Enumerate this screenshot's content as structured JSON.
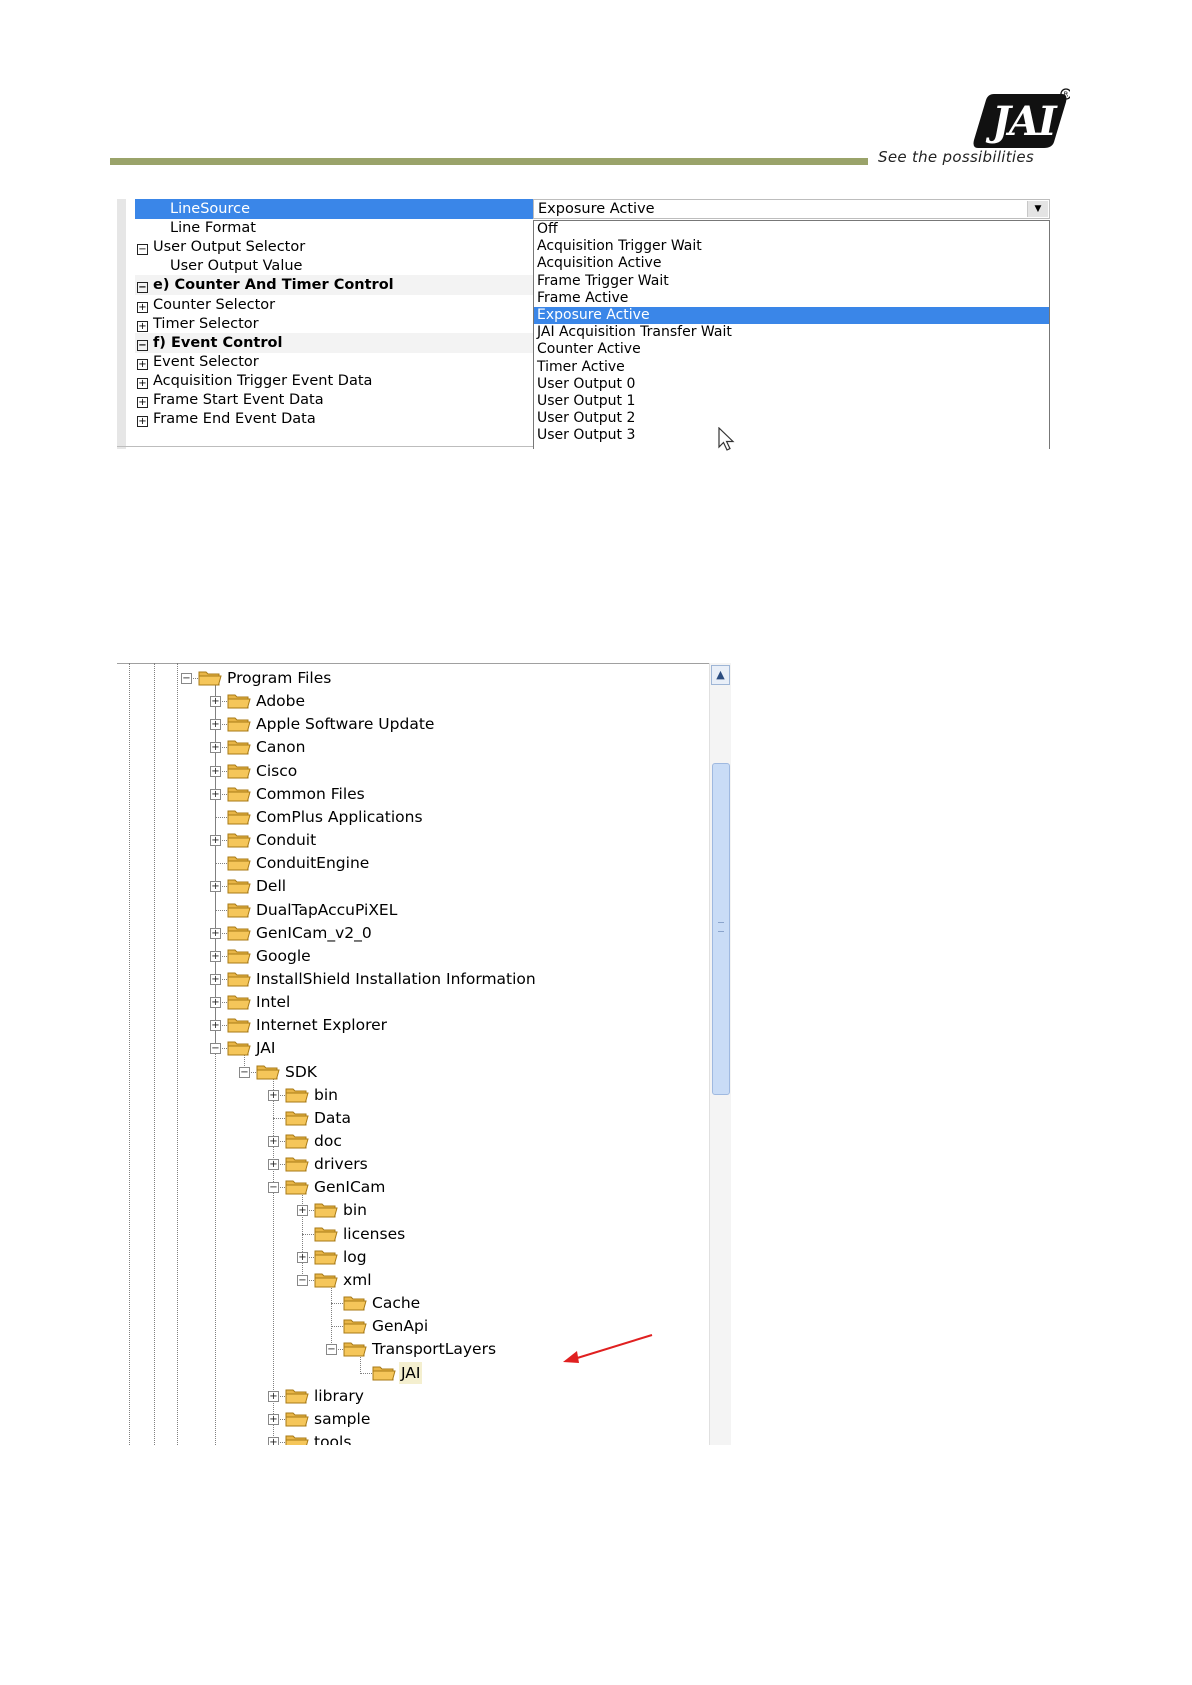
{
  "header": {
    "logo_text": "JAI",
    "tagline": "See the possibilities",
    "rule_color": "#9aa36a"
  },
  "grid": {
    "rows": [
      {
        "label": "LineSource",
        "expander": "",
        "indent": true,
        "style": "sel"
      },
      {
        "label": "Line Format",
        "expander": "",
        "indent": true,
        "style": ""
      },
      {
        "label": "User Output Selector",
        "expander": "⊟",
        "indent": false,
        "style": ""
      },
      {
        "label": "User Output Value",
        "expander": "",
        "indent": true,
        "style": ""
      },
      {
        "label": "e) Counter And Timer Control",
        "expander": "⊟",
        "indent": false,
        "style": "bold alt"
      },
      {
        "label": "Counter Selector",
        "expander": "⊞",
        "indent": false,
        "style": ""
      },
      {
        "label": "Timer Selector",
        "expander": "⊞",
        "indent": false,
        "style": ""
      },
      {
        "label": "f) Event Control",
        "expander": "⊟",
        "indent": false,
        "style": "bold alt"
      },
      {
        "label": "Event Selector",
        "expander": "⊞",
        "indent": false,
        "style": ""
      },
      {
        "label": "Acquisition Trigger Event Data",
        "expander": "⊞",
        "indent": false,
        "style": ""
      },
      {
        "label": "Frame Start Event Data",
        "expander": "⊞",
        "indent": false,
        "style": ""
      },
      {
        "label": "Frame End Event Data",
        "expander": "⊞",
        "indent": false,
        "style": ""
      }
    ],
    "combo_value": "Exposure Active",
    "dropdown_options": [
      "Off",
      "Acquisition Trigger Wait",
      "Acquisition Active",
      "Frame Trigger Wait",
      "Frame Active",
      "Exposure Active",
      "JAI Acquisition Transfer Wait",
      "Counter Active",
      "Timer Active",
      "User Output 0",
      "User Output 1",
      "User Output 2",
      "User Output 3"
    ],
    "selected_option": "Exposure Active",
    "selection_color": "#3a86e8"
  },
  "tree": {
    "items": [
      {
        "label": "Program Files",
        "depth": 0,
        "expander": "minus"
      },
      {
        "label": "Adobe",
        "depth": 1,
        "expander": "plus"
      },
      {
        "label": "Apple Software Update",
        "depth": 1,
        "expander": "plus"
      },
      {
        "label": "Canon",
        "depth": 1,
        "expander": "plus"
      },
      {
        "label": "Cisco",
        "depth": 1,
        "expander": "plus"
      },
      {
        "label": "Common Files",
        "depth": 1,
        "expander": "plus"
      },
      {
        "label": "ComPlus Applications",
        "depth": 1,
        "expander": "none"
      },
      {
        "label": "Conduit",
        "depth": 1,
        "expander": "plus"
      },
      {
        "label": "ConduitEngine",
        "depth": 1,
        "expander": "none"
      },
      {
        "label": "Dell",
        "depth": 1,
        "expander": "plus"
      },
      {
        "label": "DualTapAccuPiXEL",
        "depth": 1,
        "expander": "none"
      },
      {
        "label": "GenICam_v2_0",
        "depth": 1,
        "expander": "plus"
      },
      {
        "label": "Google",
        "depth": 1,
        "expander": "plus"
      },
      {
        "label": "InstallShield Installation Information",
        "depth": 1,
        "expander": "plus"
      },
      {
        "label": "Intel",
        "depth": 1,
        "expander": "plus"
      },
      {
        "label": "Internet Explorer",
        "depth": 1,
        "expander": "plus"
      },
      {
        "label": "JAI",
        "depth": 1,
        "expander": "minus"
      },
      {
        "label": "SDK",
        "depth": 2,
        "expander": "minus"
      },
      {
        "label": "bin",
        "depth": 3,
        "expander": "plus"
      },
      {
        "label": "Data",
        "depth": 3,
        "expander": "none"
      },
      {
        "label": "doc",
        "depth": 3,
        "expander": "plus"
      },
      {
        "label": "drivers",
        "depth": 3,
        "expander": "plus"
      },
      {
        "label": "GenICam",
        "depth": 3,
        "expander": "minus"
      },
      {
        "label": "bin",
        "depth": 4,
        "expander": "plus"
      },
      {
        "label": "licenses",
        "depth": 4,
        "expander": "none"
      },
      {
        "label": "log",
        "depth": 4,
        "expander": "plus"
      },
      {
        "label": "xml",
        "depth": 4,
        "expander": "minus"
      },
      {
        "label": "Cache",
        "depth": 5,
        "expander": "none"
      },
      {
        "label": "GenApi",
        "depth": 5,
        "expander": "none"
      },
      {
        "label": "TransportLayers",
        "depth": 5,
        "expander": "minus"
      },
      {
        "label": "JAI",
        "depth": 6,
        "expander": "none",
        "highlight": true
      },
      {
        "label": "library",
        "depth": 3,
        "expander": "plus"
      },
      {
        "label": "sample",
        "depth": 3,
        "expander": "plus"
      },
      {
        "label": "tools",
        "depth": 3,
        "expander": "plus"
      }
    ],
    "folder_color": "#f5c65a",
    "annotation_arrow_color": "#e02020"
  }
}
